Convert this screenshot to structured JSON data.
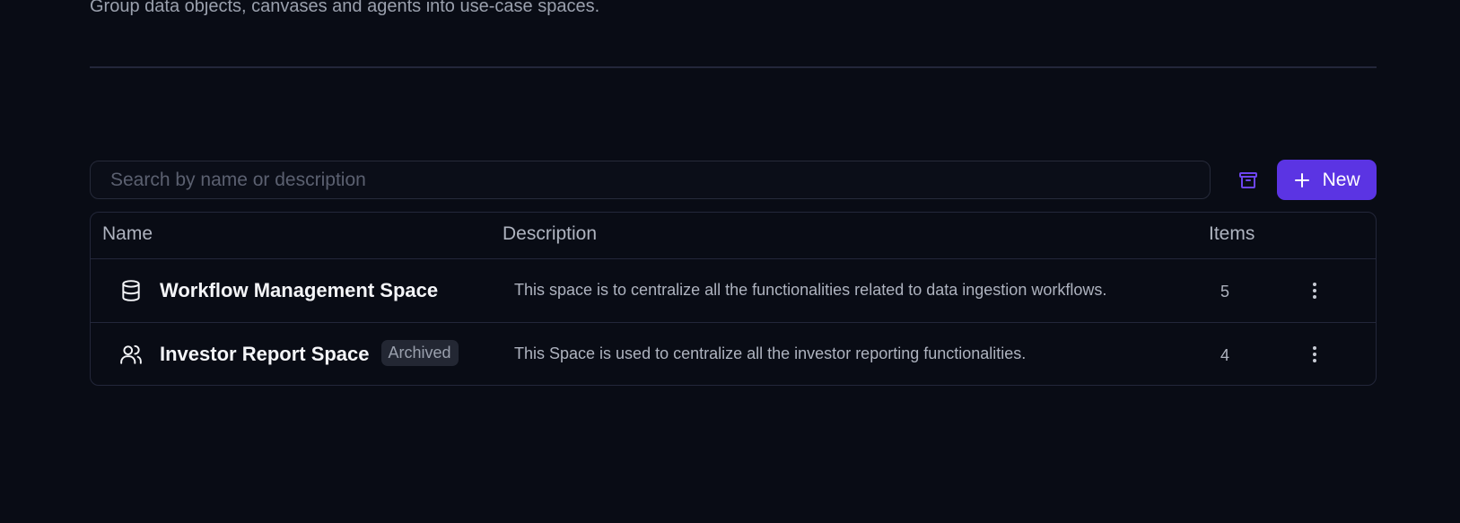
{
  "header": {
    "subtitle": "Group data objects, canvases and agents into use-case spaces."
  },
  "toolbar": {
    "search_placeholder": "Search by name or description",
    "archive_icon": "archive-icon",
    "new_label": "New",
    "new_icon": "plus-icon"
  },
  "colors": {
    "background": "#090c15",
    "accent": "#5b34e3",
    "border": "#23273a"
  },
  "table": {
    "columns": {
      "name": "Name",
      "description": "Description",
      "items": "Items"
    },
    "rows": [
      {
        "icon": "database-icon",
        "name": "Workflow Management Space",
        "badge": "",
        "description": "This space is to centralize all the functionalities related to data ingestion workflows.",
        "items": "5"
      },
      {
        "icon": "users-icon",
        "name": "Investor Report Space",
        "badge": "Archived",
        "description": "This Space is used to centralize all the investor reporting functionalities.",
        "items": "4"
      }
    ]
  }
}
